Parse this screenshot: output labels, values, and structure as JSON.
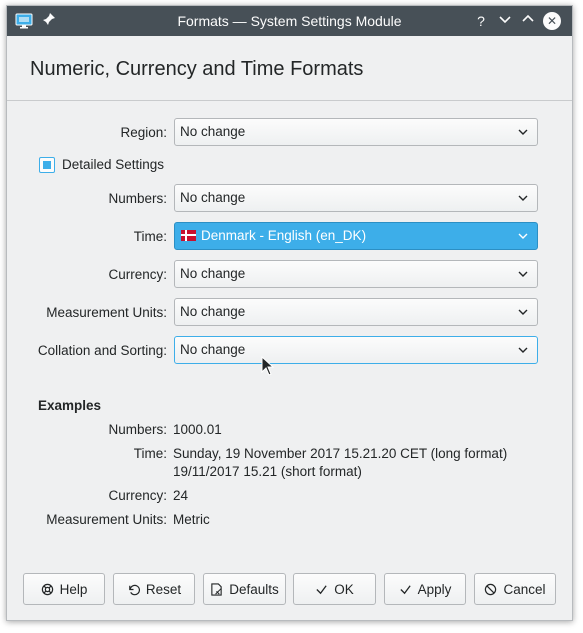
{
  "window": {
    "title": "Formats — System Settings Module",
    "help_glyph": "?",
    "minimize_glyph": "⌄",
    "maximize_glyph": "⌃",
    "close_glyph": "✕"
  },
  "heading": "Numeric, Currency and Time Formats",
  "region": {
    "label": "Region:",
    "value": "No change"
  },
  "detailed_settings": {
    "label": "Detailed Settings",
    "checked": true
  },
  "fields": [
    {
      "label": "Numbers:",
      "value": "No change"
    },
    {
      "label": "Time:",
      "value": "Denmark - English (en_DK)",
      "flag": "denmark-flag-icon"
    },
    {
      "label": "Currency:",
      "value": "No change"
    },
    {
      "label": "Measurement Units:",
      "value": "No change"
    },
    {
      "label": "Collation and Sorting:",
      "value": "No change"
    }
  ],
  "examples": {
    "title": "Examples",
    "numbers": {
      "label": "Numbers:",
      "value": "1000.01"
    },
    "time": {
      "label": "Time:",
      "long": "Sunday, 19 November 2017 15.21.20 CET (long format)",
      "short": "19/11/2017 15.21 (short format)"
    },
    "currency": {
      "label": "Currency:",
      "value": "24"
    },
    "measurement": {
      "label": "Measurement Units:",
      "value": "Metric"
    }
  },
  "buttons": {
    "help": "Help",
    "reset": "Reset",
    "defaults": "Defaults",
    "ok": "OK",
    "apply": "Apply",
    "cancel": "Cancel"
  },
  "colors": {
    "accent": "#3daee9",
    "titlebar": "#475057",
    "window_bg": "#eff0f1"
  }
}
